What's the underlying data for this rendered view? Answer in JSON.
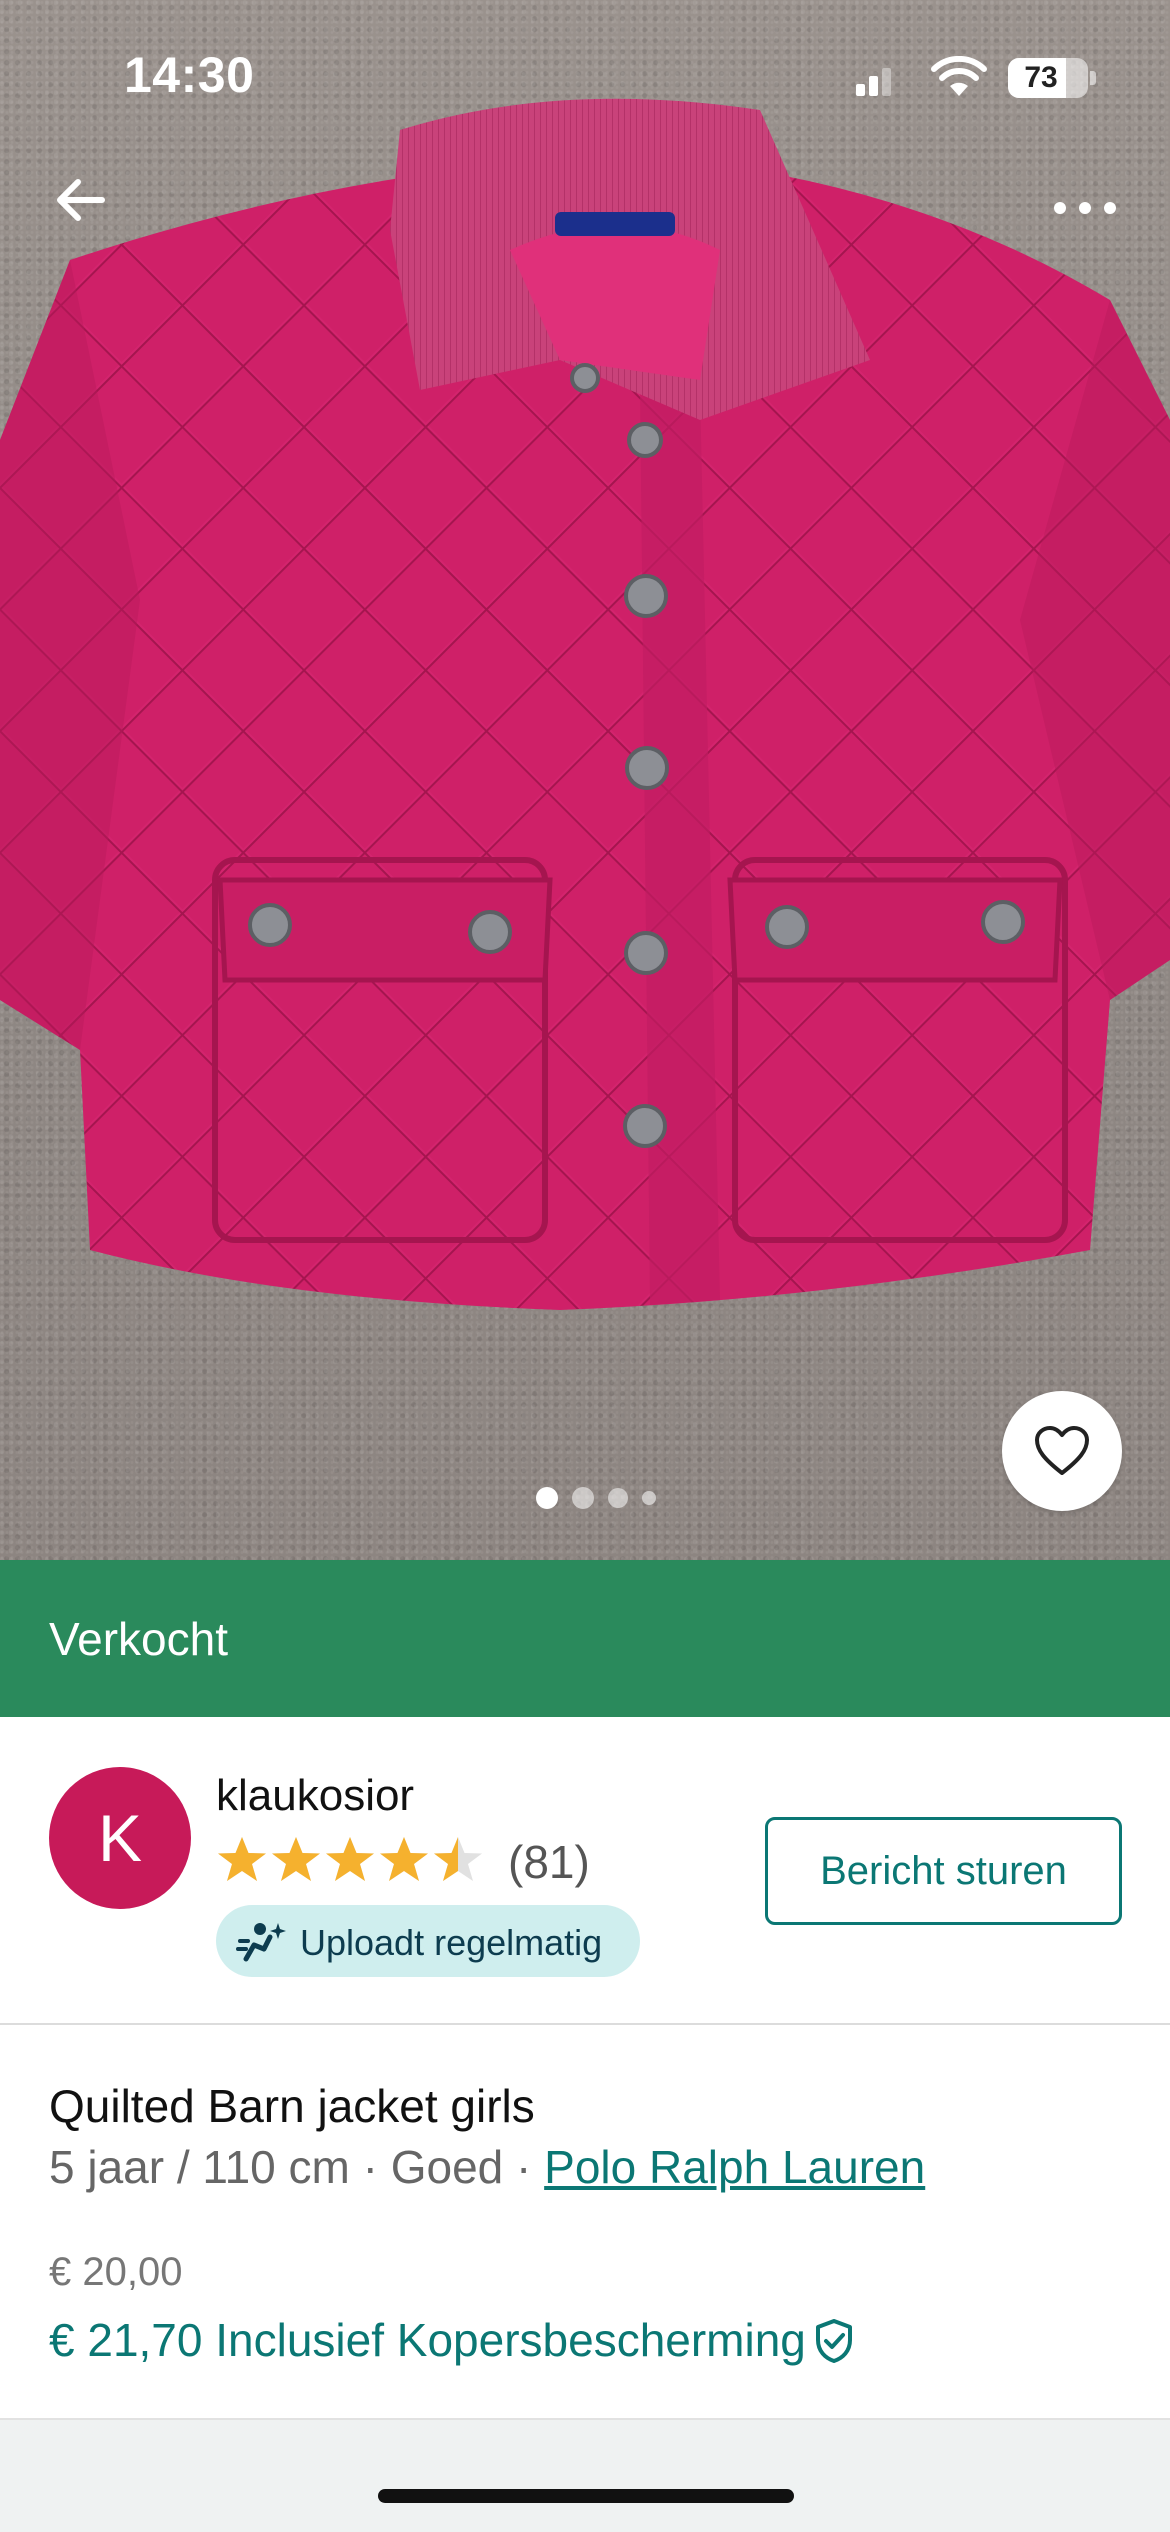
{
  "status_bar": {
    "time": "14:30",
    "battery": "73",
    "battery_level": 0.73
  },
  "gallery": {
    "image_count": 4,
    "current_index": 0,
    "image_subject": "pink quilted jacket"
  },
  "sold_label": "Verkocht",
  "seller": {
    "avatar_letter": "K",
    "avatar_color": "#c71a59",
    "name": "klaukosior",
    "rating": 4.5,
    "rating_max": 5,
    "review_count": "(81)",
    "badge_label": "Uploadt regelmatig",
    "message_button": "Bericht sturen"
  },
  "item": {
    "title": "Quilted Barn jacket girls",
    "size": "5 jaar / 110 cm",
    "separator": " · ",
    "condition": "Goed",
    "brand": "Polo Ralph Lauren",
    "price": "€ 20,00",
    "price_with_protection": "€ 21,70 Inclusief Kopersbescherming"
  },
  "colors": {
    "sold_banner": "#2a8a5c",
    "accent_teal": "#0b7774",
    "star": "#f5b12e",
    "badge_bg": "#cfeeee"
  },
  "icons": [
    "back-arrow-icon",
    "more-dots-icon",
    "heart-icon",
    "star-icon",
    "upload-icon",
    "shield-check-icon"
  ]
}
